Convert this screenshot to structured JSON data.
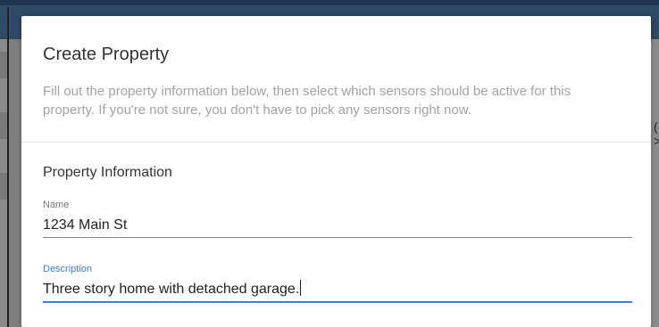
{
  "dialog": {
    "title": "Create Property",
    "subtitle": "Fill out the property information below, then select which sensors should be active for this property. If you're not sure, you don't have to pick any sensors right now.",
    "section_title": "Property Information",
    "fields": {
      "name": {
        "label": "Name",
        "value": "1234 Main St"
      },
      "description": {
        "label": "Description",
        "value": "Three story home with detached garage."
      }
    }
  },
  "background": {
    "right_glyphs": [
      "(",
      ">"
    ]
  },
  "colors": {
    "accent": "#3b7dd8",
    "topbar": "#2e4a68",
    "subtitle_text": "#a3a3a3"
  }
}
